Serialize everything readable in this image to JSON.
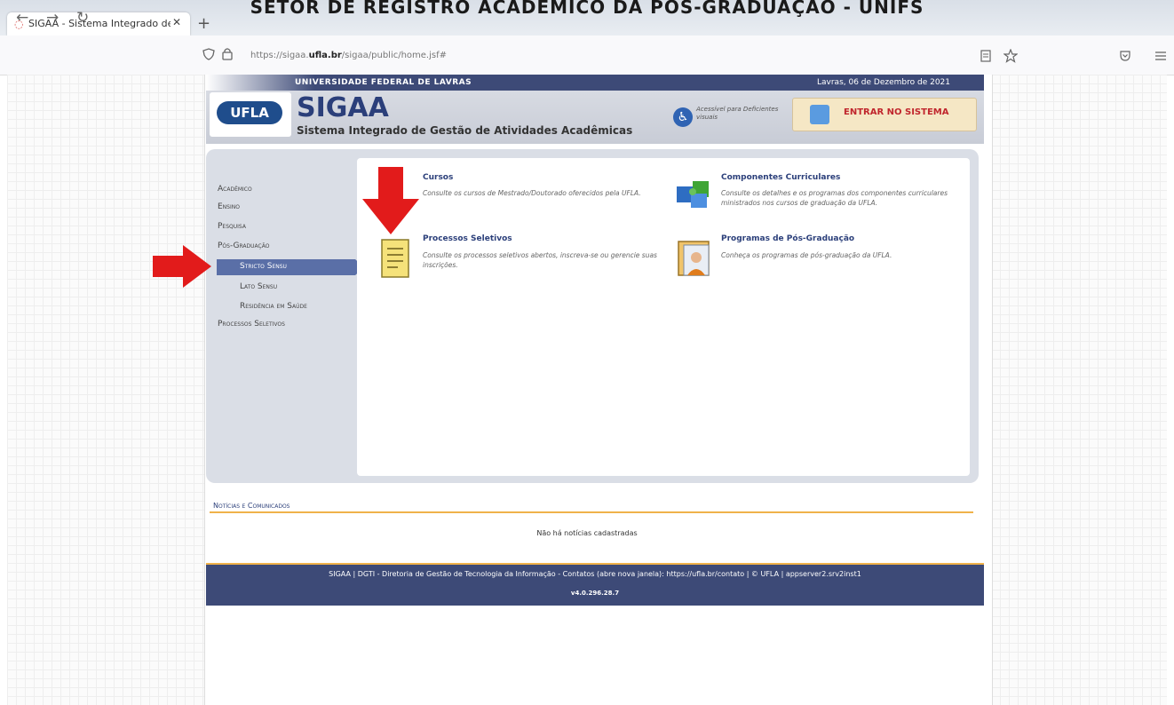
{
  "banner": "SETOR DE REGISTRO ACADÊMICO DA PÓS-GRADUAÇÃO - UNIFS",
  "browser": {
    "tab_title": "SIGAA - Sistema Integrado de G",
    "tab_close": "✕",
    "new_tab": "+",
    "url_prefix": "https://sigaa.",
    "url_host": "ufla.br",
    "url_path": "/sigaa/public/home.jsf#",
    "back_icon": "←",
    "forward_icon": "→",
    "reload_icon": "↻"
  },
  "header": {
    "university": "UNIVERSIDADE FEDERAL DE LAVRAS",
    "date": "Lavras, 06 de Dezembro de 2021",
    "logo_text": "UFLA",
    "title": "SIGAA",
    "subtitle": "Sistema Integrado de Gestão de Atividades Acadêmicas",
    "accessibility": "Acessível para Deficientes visuais",
    "login": "ENTRAR NO SISTEMA"
  },
  "menu": {
    "items": [
      "Acadêmico",
      "Ensino",
      "Pesquisa",
      "Pós-Graduação",
      "Stricto Sensu",
      "Lato Sensu",
      "Residência em Saúde",
      "Processos Seletivos"
    ],
    "active": "Stricto Sensu"
  },
  "cards": [
    {
      "title": "Cursos",
      "desc": "Consulte os cursos de Mestrado/Doutorado oferecidos pela UFLA."
    },
    {
      "title": "Componentes Curriculares",
      "desc": "Consulte os detalhes e os programas dos componentes curriculares ministrados nos cursos de graduação da UFLA."
    },
    {
      "title": "Processos Seletivos",
      "desc": "Consulte os processos seletivos abertos, inscreva-se ou gerencie suas inscrições."
    },
    {
      "title": "Programas de Pós-Graduação",
      "desc": "Conheça os programas de pós-graduação da UFLA."
    }
  ],
  "news": {
    "title": "Notícias e Comunicados",
    "empty": "Não há notícias cadastradas"
  },
  "footer": {
    "text": "SIGAA | DGTI - Diretoria de Gestão de Tecnologia da Informação - Contatos (abre nova janela): https://ufla.br/contato | © UFLA | appserver2.srv2inst1",
    "version": "v4.0.296.28.7"
  },
  "colors": {
    "accent": "#3d4a77",
    "arrow": "#e21b1b",
    "login_text": "#c0262d"
  }
}
